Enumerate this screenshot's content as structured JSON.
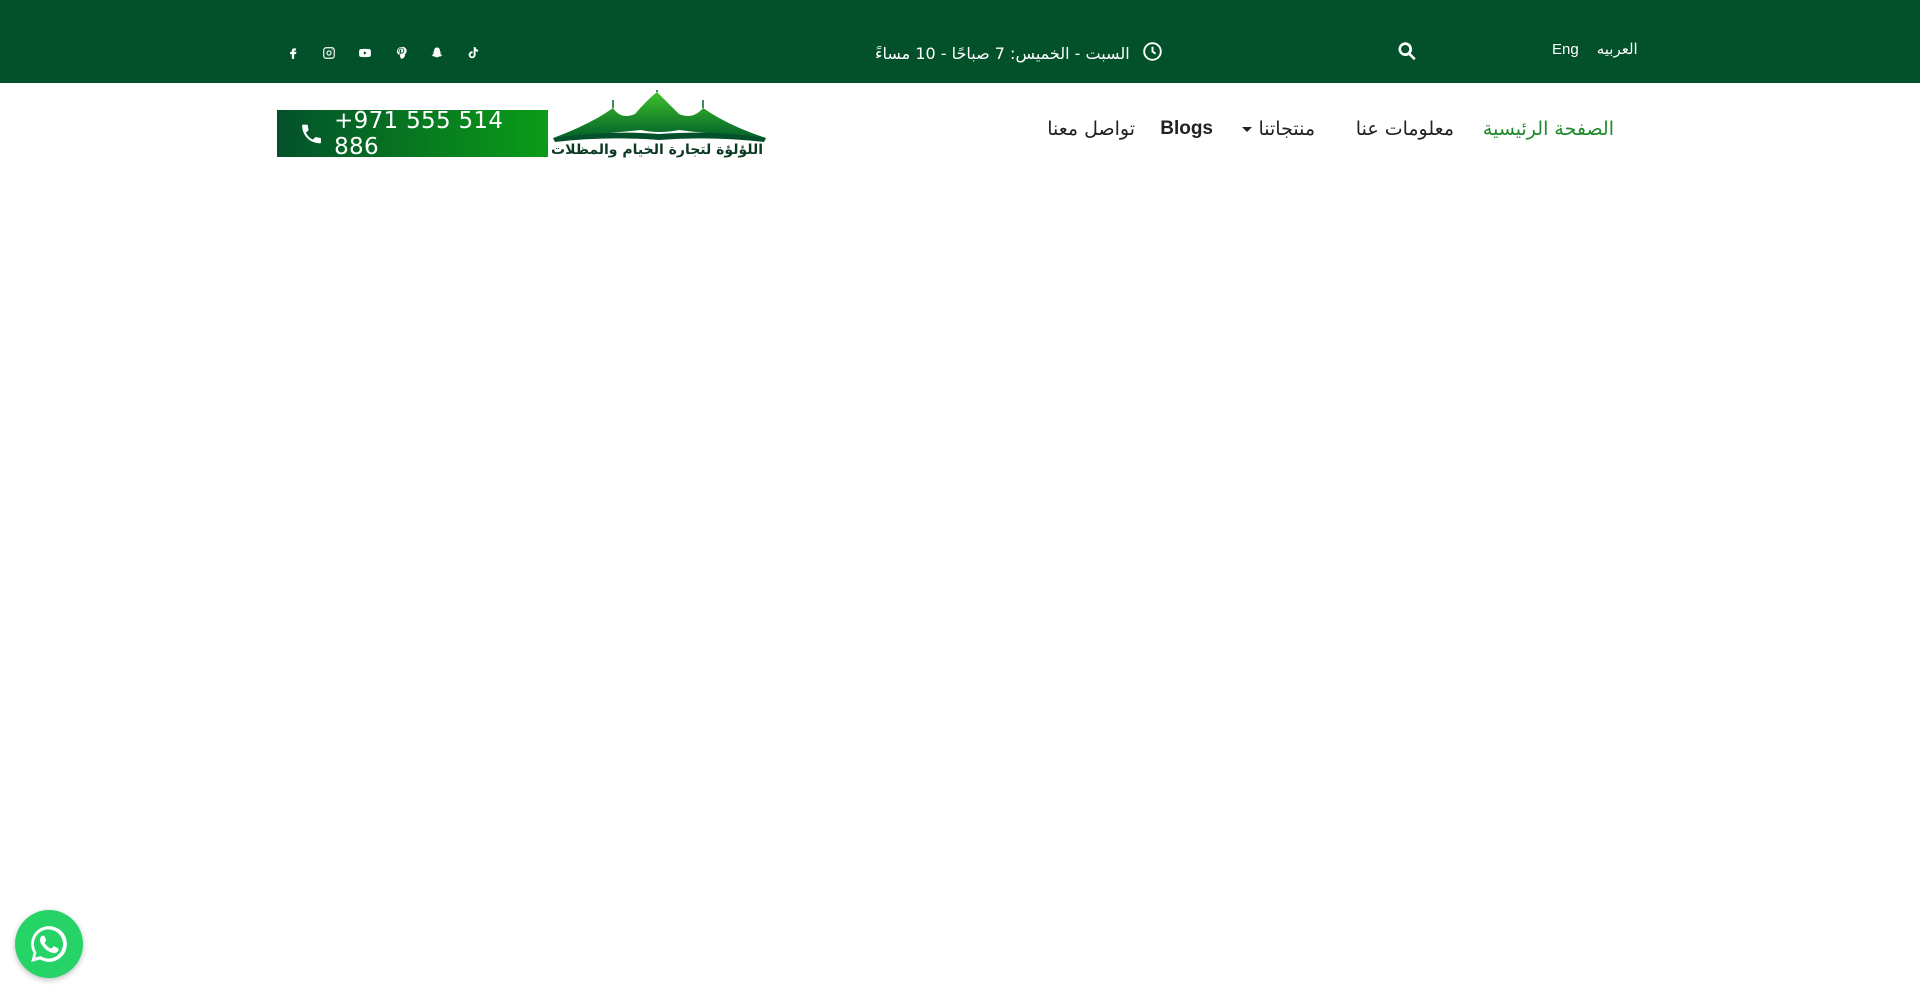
{
  "topbar": {
    "social_icons": [
      "facebook-icon",
      "instagram-icon",
      "youtube-icon",
      "pinterest-icon",
      "snapchat-icon",
      "tiktok-icon"
    ],
    "hours_text": "السبت - الخميس: 7 صباحًا - 10 مساءً",
    "languages": {
      "english": "Eng",
      "arabic": "العربيه"
    }
  },
  "header": {
    "phone": "+971 555 514 886",
    "logo_text": "اللؤلؤة لتجارة الخيام والمظلات",
    "nav": {
      "home": "الصفحة الرئيسية",
      "about": "معلومات عنا",
      "products": "منتجاتنا",
      "blogs": "Blogs",
      "contact": "تواصل معنا"
    }
  },
  "colors": {
    "topbar": "#03512a",
    "accent_green": "#1f8a2b",
    "whatsapp": "#25d366"
  }
}
